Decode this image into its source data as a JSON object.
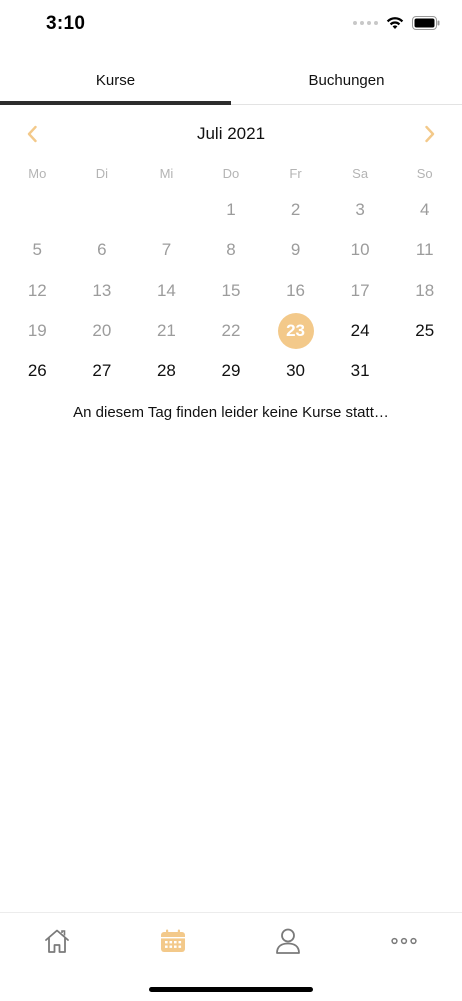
{
  "status_bar": {
    "time": "3:10"
  },
  "tabs": [
    {
      "label": "Kurse",
      "active": true
    },
    {
      "label": "Buchungen",
      "active": false
    }
  ],
  "calendar": {
    "month_label": "Juli 2021",
    "weekdays": [
      "Mo",
      "Di",
      "Mi",
      "Do",
      "Fr",
      "Sa",
      "So"
    ],
    "leading_blanks": 3,
    "days_in_month": 31,
    "today": 23,
    "selected": 23
  },
  "empty_message": "An diesem Tag finden leider keine Kurse statt…",
  "colors": {
    "accent": "#f3c98a",
    "tab_indicator": "#2d2d2d",
    "muted_text": "#9c9c9c"
  },
  "tabbar": {
    "items": [
      {
        "icon": "home-icon",
        "active": false
      },
      {
        "icon": "calendar-icon",
        "active": true
      },
      {
        "icon": "person-icon",
        "active": false
      },
      {
        "icon": "more-icon",
        "active": false
      }
    ]
  }
}
